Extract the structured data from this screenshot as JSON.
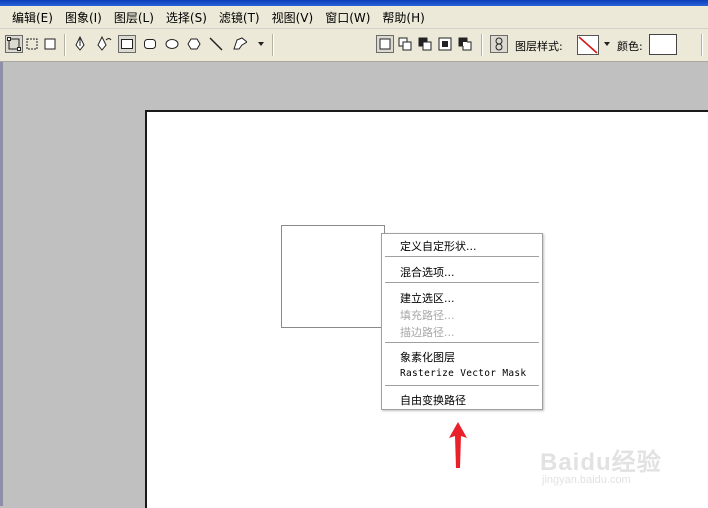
{
  "menubar": {
    "items": [
      "编辑(E)",
      "图象(I)",
      "图层(L)",
      "选择(S)",
      "滤镜(T)",
      "视图(V)",
      "窗口(W)",
      "帮助(H)"
    ]
  },
  "optionsbar": {
    "layer_style_label": "图层样式:",
    "color_label": "颜色:",
    "icons": [
      "shape-layers-icon",
      "paths-icon",
      "fill-pixels-icon",
      "pen-icon",
      "freeform-pen-icon",
      "rectangle-icon",
      "rounded-rectangle-icon",
      "ellipse-icon",
      "polygon-icon",
      "line-icon",
      "custom-shape-icon",
      "create-new-layer-icon",
      "add-to-area-icon",
      "subtract-area-icon",
      "intersect-area-icon",
      "exclude-area-icon",
      "link-icon",
      "no-style-icon"
    ]
  },
  "context_menu": {
    "items": [
      {
        "label": "定义自定形状...",
        "enabled": true
      },
      {
        "label": "混合选项...",
        "enabled": true
      },
      {
        "label": "建立选区...",
        "enabled": true
      },
      {
        "label": "填充路径...",
        "enabled": false
      },
      {
        "label": "描边路径...",
        "enabled": false
      },
      {
        "label": "象素化图层",
        "enabled": true
      },
      {
        "label": "Rasterize Vector Mask",
        "enabled": true
      },
      {
        "label": "自由变换路径",
        "enabled": true
      }
    ]
  },
  "watermark": {
    "main": "Baidu经验",
    "sub": "jingyan.baidu.com"
  },
  "colors": {
    "arrow": "#e8212a",
    "menu_bg": "#ece9d8",
    "canvas_bg": "#c0c0c0"
  }
}
